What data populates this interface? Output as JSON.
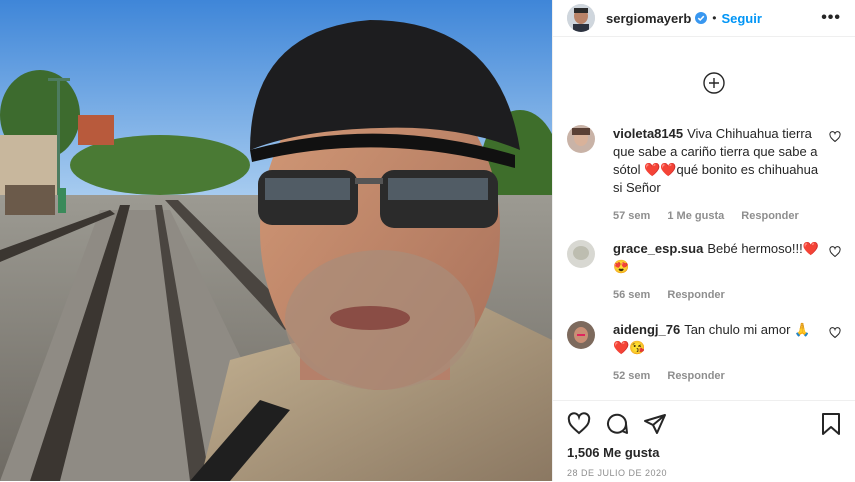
{
  "post": {
    "username": "sergiomayerb",
    "dot": "•",
    "follow_label": "Seguir",
    "more_label": "•••"
  },
  "comments": [
    {
      "user": "violeta8145",
      "text": "Viva Chihuahua tierra que sabe a cariño tierra que sabe a sótol ❤️❤️qué bonito es chihuahua si Señor",
      "time": "57 sem",
      "likes": "1 Me gusta",
      "reply": "Responder"
    },
    {
      "user": "grace_esp.sua",
      "text": "Bebé hermoso!!!❤️😍",
      "time": "56 sem",
      "reply": "Responder"
    },
    {
      "user": "aidengj_76",
      "text": "Tan chulo mi amor 🙏❤️😘",
      "time": "52 sem",
      "reply": "Responder"
    }
  ],
  "footer": {
    "likes_count": "1,506 Me gusta",
    "date": "28 de julio de 2020"
  },
  "colors": {
    "accent": "#0095f6",
    "meta": "#8e8e8e",
    "text": "#262626"
  },
  "icons": [
    "verified-icon",
    "more-options-icon",
    "add-comment-icon",
    "heart-icon",
    "comment-icon",
    "share-icon",
    "save-icon"
  ]
}
